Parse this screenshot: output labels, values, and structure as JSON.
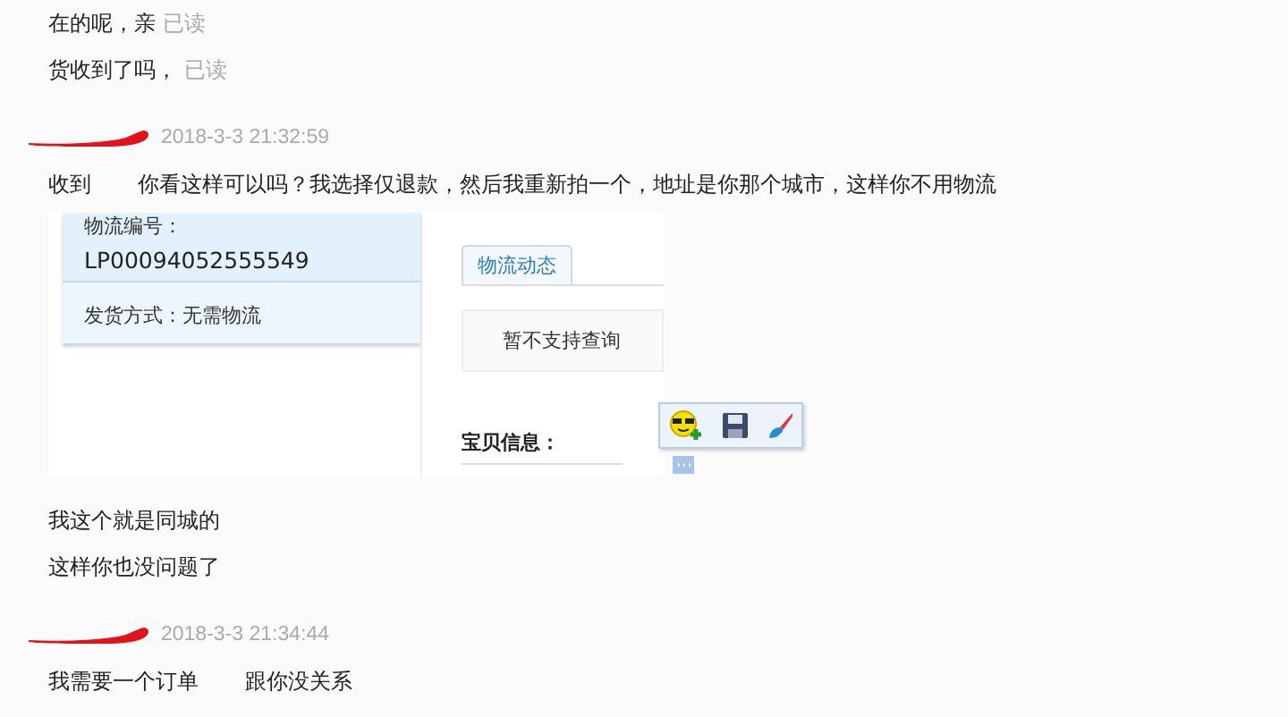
{
  "messages": [
    {
      "kind": "text",
      "parts": [
        "在的呢，亲"
      ],
      "status": "已读"
    },
    {
      "kind": "text",
      "parts": [
        "货收到了吗，"
      ],
      "status": "已读"
    },
    {
      "kind": "header",
      "redacted": true,
      "time": "2018-3-3 21:32:59"
    },
    {
      "kind": "text",
      "parts": [
        "收到",
        "你看这样可以吗？我选择仅退款，然后我重新拍一个，地址是你那个城市，这样你不用物流"
      ]
    },
    {
      "kind": "screenshot",
      "tracking_label": "物流编号：",
      "tracking_number": "LP00094052555549",
      "shipping": "发货方式：无需物流",
      "tab": "物流动态",
      "tracking_status": "暂不支持查询",
      "section": "宝贝信息："
    },
    {
      "kind": "text",
      "parts": [
        "我这个就是同城的"
      ]
    },
    {
      "kind": "text",
      "parts": [
        "这样你也没问题了"
      ]
    },
    {
      "kind": "header",
      "redacted": true,
      "time": "2018-3-3 21:34:44"
    },
    {
      "kind": "text",
      "parts": [
        "我需要一个订单",
        "跟你没关系"
      ]
    }
  ]
}
